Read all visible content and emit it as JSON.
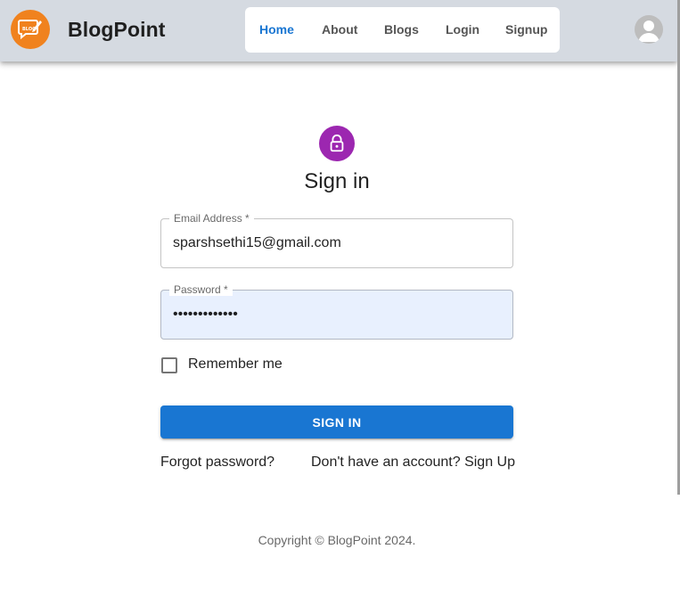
{
  "header": {
    "brand": "BlogPoint",
    "logo_icon": "blog-chat-pencil-icon",
    "nav": [
      {
        "label": "Home",
        "active": true
      },
      {
        "label": "About",
        "active": false
      },
      {
        "label": "Blogs",
        "active": false
      },
      {
        "label": "Login",
        "active": false
      },
      {
        "label": "Signup",
        "active": false
      }
    ],
    "avatar_icon": "person-icon"
  },
  "signin": {
    "icon": "lock-icon",
    "title": "Sign in",
    "email": {
      "label": "Email Address *",
      "value": "sparshsethi15@gmail.com"
    },
    "password": {
      "label": "Password *",
      "value": "•••••••••••••"
    },
    "remember_label": "Remember me",
    "submit_label": "SIGN IN",
    "forgot_label": "Forgot password?",
    "signup_label": "Don't have an account? Sign Up"
  },
  "footer": {
    "copyright": "Copyright © BlogPoint 2024."
  },
  "colors": {
    "appbar": "#d5dae1",
    "logo": "#f0821e",
    "primary": "#1976d2",
    "lock_avatar": "#9c27b0",
    "autofill": "#e8f0fe"
  }
}
